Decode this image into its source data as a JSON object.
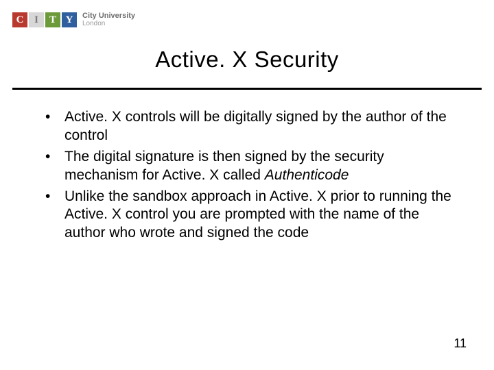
{
  "logo": {
    "tiles": [
      {
        "letter": "C",
        "bg": "#b83a2f",
        "fg": "#ffffff"
      },
      {
        "letter": "I",
        "bg": "#d7d7d7",
        "fg": "#7a7a7a"
      },
      {
        "letter": "T",
        "bg": "#6c9a3a",
        "fg": "#ffffff"
      },
      {
        "letter": "Y",
        "bg": "#2f5f9e",
        "fg": "#ffffff"
      }
    ],
    "line1": "City University",
    "line2": "London"
  },
  "title": "Active. X  Security",
  "bullets": [
    {
      "pre": "Active. X controls will be digitally signed by the author of the control",
      "ital": "",
      "post": ""
    },
    {
      "pre": "The digital signature is then signed by the security mechanism for Active. X called ",
      "ital": "Authenticode",
      "post": ""
    },
    {
      "pre": "Unlike the sandbox approach in Active. X prior to running the Active. X control you are prompted with the name of the author who wrote and signed the code",
      "ital": "",
      "post": ""
    }
  ],
  "page_number": "11"
}
